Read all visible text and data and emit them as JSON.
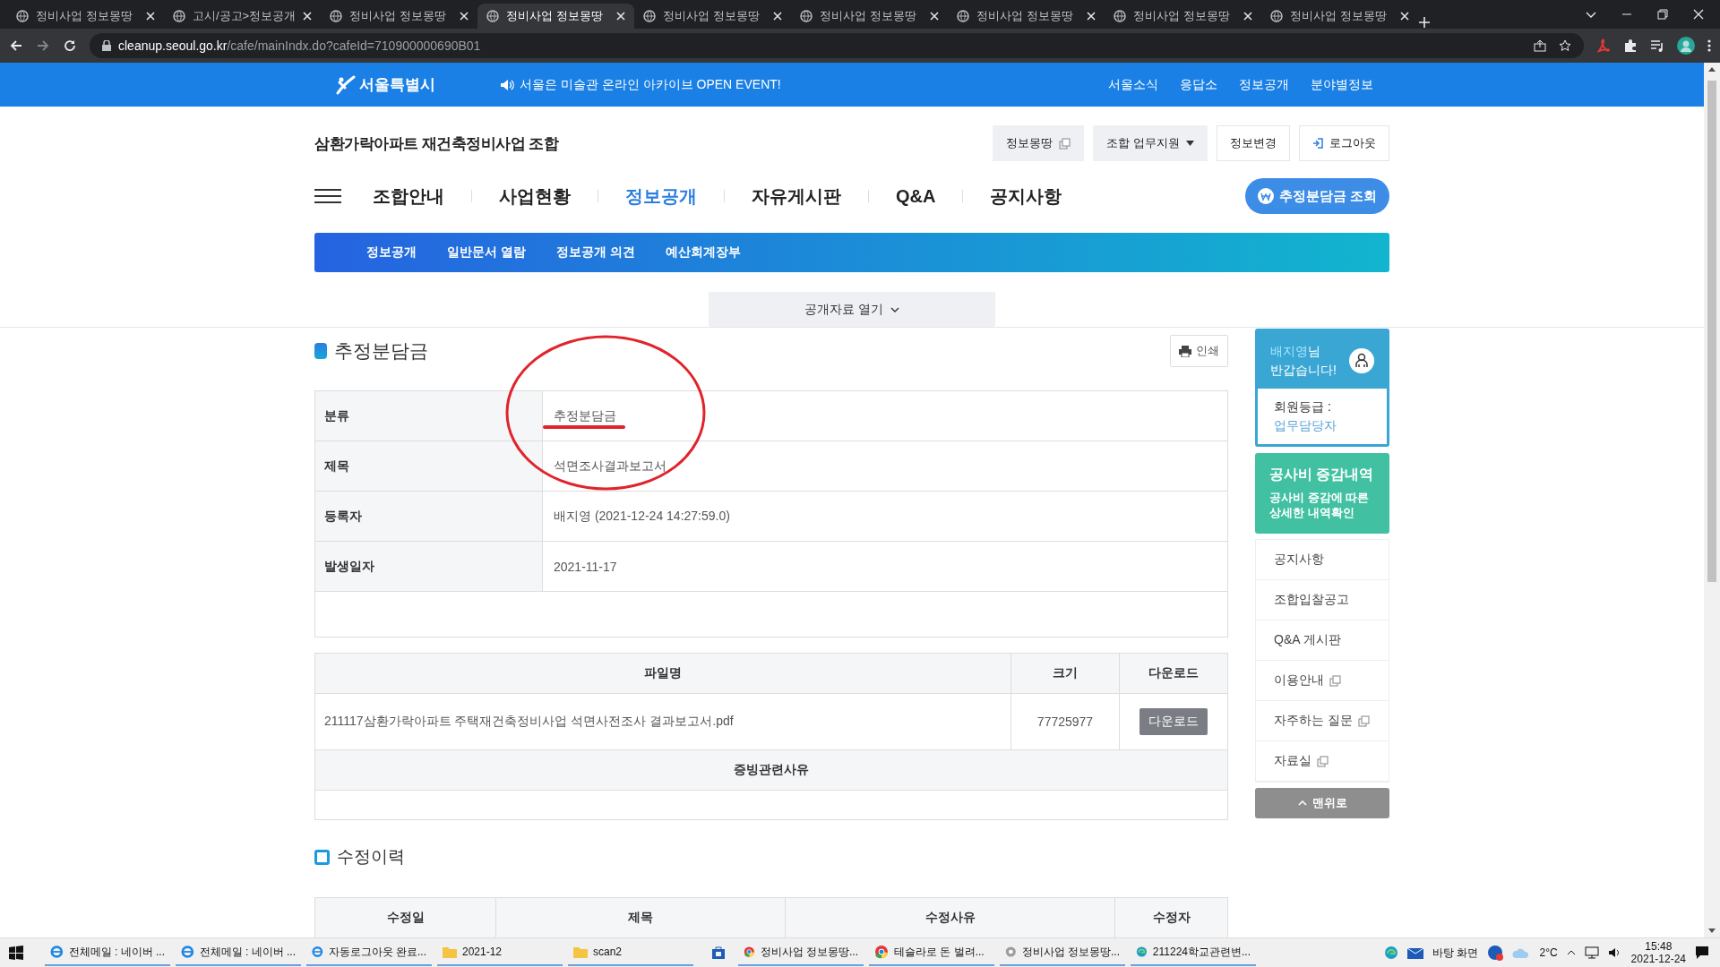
{
  "browser": {
    "tabs": [
      {
        "title": "정비사업 정보몽땅",
        "selected": false
      },
      {
        "title": "고시/공고>정보공개",
        "selected": false
      },
      {
        "title": "정비사업 정보몽땅",
        "selected": false
      },
      {
        "title": "정비사업 정보몽땅",
        "selected": true
      },
      {
        "title": "정비사업 정보몽땅",
        "selected": false
      },
      {
        "title": "정비사업 정보몽땅",
        "selected": false
      },
      {
        "title": "정비사업 정보몽땅",
        "selected": false
      },
      {
        "title": "정비사업 정보몽땅",
        "selected": false
      },
      {
        "title": "정비사업 정보몽땅",
        "selected": false
      }
    ],
    "url_host": "cleanup.seoul.go.kr",
    "url_path": "/cafe/mainIndx.do?cafeId=710900000690B01"
  },
  "top_bar": {
    "logo": "서울특별시",
    "notice": "서울은 미술관 온라인 아카이브 OPEN EVENT!",
    "links": [
      "서울소식",
      "응답소",
      "정보공개",
      "분야별정보"
    ]
  },
  "header": {
    "title": "삼환가락아파트 재건축정비사업 조합",
    "buttons": [
      {
        "label": "정보몽땅",
        "kind": "external"
      },
      {
        "label": "조합 업무지원",
        "kind": "dropdown"
      },
      {
        "label": "정보변경",
        "kind": "plain"
      },
      {
        "label": "로그아웃",
        "kind": "logout"
      }
    ]
  },
  "main_nav": {
    "items": [
      {
        "label": "조합안내",
        "selected": false
      },
      {
        "label": "사업현황",
        "selected": false
      },
      {
        "label": "정보공개",
        "selected": true
      },
      {
        "label": "자유게시판",
        "selected": false
      },
      {
        "label": "Q&A",
        "selected": false
      },
      {
        "label": "공지사항",
        "selected": false
      }
    ],
    "action": "추정분담금 조회"
  },
  "sub_nav": [
    "정보공개",
    "일반문서 열람",
    "정보공개 의견",
    "예산회계장부"
  ],
  "open_toggle": "공개자료 열기",
  "detail": {
    "title": "추정분담금",
    "print": "인쇄",
    "rows": [
      {
        "label": "분류",
        "value": "추정분담금"
      },
      {
        "label": "제목",
        "value": "석면조사결과보고서"
      },
      {
        "label": "등록자",
        "value": "배지영 (2021-12-24 14:27:59.0)"
      },
      {
        "label": "발생일자",
        "value": "2021-11-17"
      }
    ]
  },
  "files": {
    "columns": [
      "파일명",
      "크기",
      "다운로드"
    ],
    "rows": [
      {
        "name": "211117삼환가락아파트 주택재건축정비사업 석면사전조사 결과보고서.pdf",
        "size": "77725977",
        "action": "다운로드"
      }
    ],
    "reason_heading": "증빙관련사유"
  },
  "history": {
    "title": "수정이력",
    "columns": [
      "수정일",
      "제목",
      "수정사유",
      "수정자"
    ]
  },
  "sidebar": {
    "user_name": "배지영",
    "user_suffix": "님",
    "greeting": "반갑습니다!",
    "grade_label": "회원등급 :",
    "grade": "업무담당자",
    "promo_title": "공사비 증감내역",
    "promo_text": "공사비 증감에 따른 상세한 내역확인",
    "links": [
      {
        "label": "공지사항",
        "external": false
      },
      {
        "label": "조합입찰공고",
        "external": false
      },
      {
        "label": "Q&A 게시판",
        "external": false
      },
      {
        "label": "이용안내",
        "external": true
      },
      {
        "label": "자주하는 질문",
        "external": true
      },
      {
        "label": "자료실",
        "external": true
      }
    ],
    "top_button": "맨위로"
  },
  "taskbar": {
    "items": [
      {
        "label": "전체메일 : 네이버 ...",
        "kind": "ie"
      },
      {
        "label": "전체메일 : 네이버 ...",
        "kind": "ie"
      },
      {
        "label": "자동로그아웃 완료...",
        "kind": "ie"
      },
      {
        "label": "2021-12",
        "kind": "folder"
      },
      {
        "label": "scan2",
        "kind": "folder"
      },
      {
        "label": "정비사업 정보몽땅...",
        "kind": "chrome"
      },
      {
        "label": "테슬라로 돈 벌려...",
        "kind": "chrome"
      },
      {
        "label": "정비사업 정보몽땅...",
        "kind": "web"
      },
      {
        "label": "211224학교관련변...",
        "kind": "edge"
      }
    ],
    "desktop": "바탕 화면",
    "weather": "2°C",
    "time": "15:48",
    "date": "2021-12-24"
  }
}
